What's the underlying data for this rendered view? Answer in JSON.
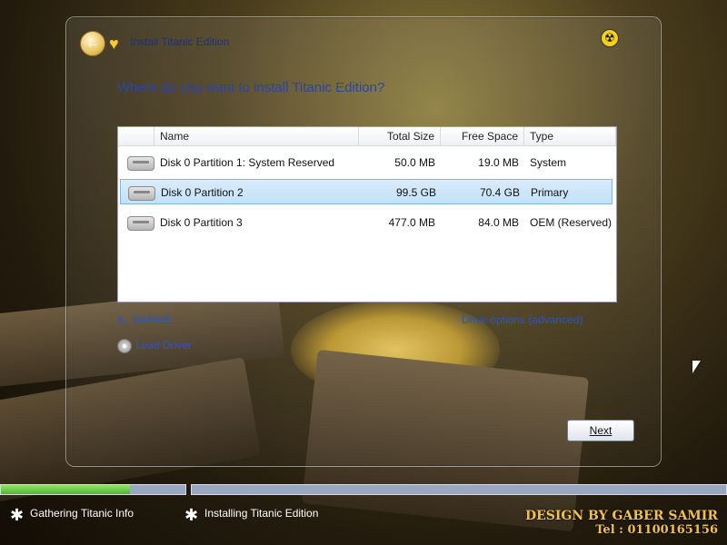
{
  "window": {
    "title": "Install Titanic Edition",
    "question": "Where do you want to install Titanic Edition?"
  },
  "table": {
    "columns": [
      "Name",
      "Total Size",
      "Free Space",
      "Type"
    ],
    "rows": [
      {
        "name": "Disk 0 Partition 1: System Reserved",
        "total": "50.0 MB",
        "free": "19.0 MB",
        "type": "System",
        "selected": false
      },
      {
        "name": "Disk 0 Partition 2",
        "total": "99.5 GB",
        "free": "70.4 GB",
        "type": "Primary",
        "selected": true
      },
      {
        "name": "Disk 0 Partition 3",
        "total": "477.0 MB",
        "free": "84.0 MB",
        "type": "OEM (Reserved)",
        "selected": false
      }
    ]
  },
  "links": {
    "refresh": "Refresh",
    "load_driver": "Load Driver",
    "drive_options": "Drive options (advanced)"
  },
  "buttons": {
    "next": "Next"
  },
  "steps": [
    {
      "label": "Gathering Titanic Info"
    },
    {
      "label": "Installing Titanic Edition"
    }
  ],
  "progress": {
    "step1_fraction": 0.7
  },
  "credit": {
    "line1": "DESIGN BY GABER SAMIR",
    "line2": "Tel : 01100165156"
  },
  "icons": {
    "back": "back-arrow-icon",
    "heart": "heart-icon",
    "hazard": "radiation-icon",
    "drive": "hard-drive-icon",
    "refresh": "refresh-icon",
    "disc": "disc-icon"
  },
  "colors": {
    "title_blue": "#2a45a8",
    "link_blue": "#2a55c8",
    "progress_green": "#52b62d",
    "selection": "#c3e1f8"
  }
}
